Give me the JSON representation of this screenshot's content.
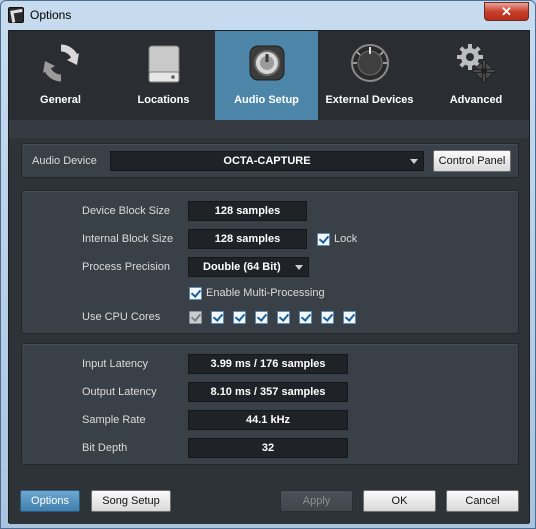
{
  "window": {
    "title": "Options",
    "close_glyph": "✕"
  },
  "tabs": [
    {
      "label": "General",
      "icon": "refresh-icon"
    },
    {
      "label": "Locations",
      "icon": "hard-drive-icon"
    },
    {
      "label": "Audio Setup",
      "icon": "speaker-knob-icon",
      "active": true
    },
    {
      "label": "External Devices",
      "icon": "knob-icon"
    },
    {
      "label": "Advanced",
      "icon": "gears-icon"
    }
  ],
  "audio_device": {
    "label": "Audio Device",
    "value": "OCTA-CAPTURE",
    "control_panel_label": "Control Panel"
  },
  "processing": {
    "device_block_size_label": "Device Block Size",
    "device_block_size_value": "128 samples",
    "internal_block_size_label": "Internal Block Size",
    "internal_block_size_value": "128 samples",
    "lock_label": "Lock",
    "lock_checked": true,
    "process_precision_label": "Process Precision",
    "process_precision_value": "Double (64 Bit)",
    "multi_processing_label": "Enable Multi-Processing",
    "multi_processing_checked": true,
    "cpu_cores_label": "Use CPU Cores",
    "cpu_cores": [
      true,
      true,
      true,
      true,
      true,
      true,
      true,
      true
    ]
  },
  "info": {
    "input_latency_label": "Input Latency",
    "input_latency_value": "3.99 ms / 176 samples",
    "output_latency_label": "Output Latency",
    "output_latency_value": "8.10 ms / 357 samples",
    "sample_rate_label": "Sample Rate",
    "sample_rate_value": "44.1 kHz",
    "bit_depth_label": "Bit Depth",
    "bit_depth_value": "32"
  },
  "footer": {
    "options_label": "Options",
    "song_setup_label": "Song Setup",
    "apply_label": "Apply",
    "ok_label": "OK",
    "cancel_label": "Cancel"
  },
  "colors": {
    "accent": "#4d86a8",
    "background": "#2e3338",
    "panel": "#3a4047"
  }
}
